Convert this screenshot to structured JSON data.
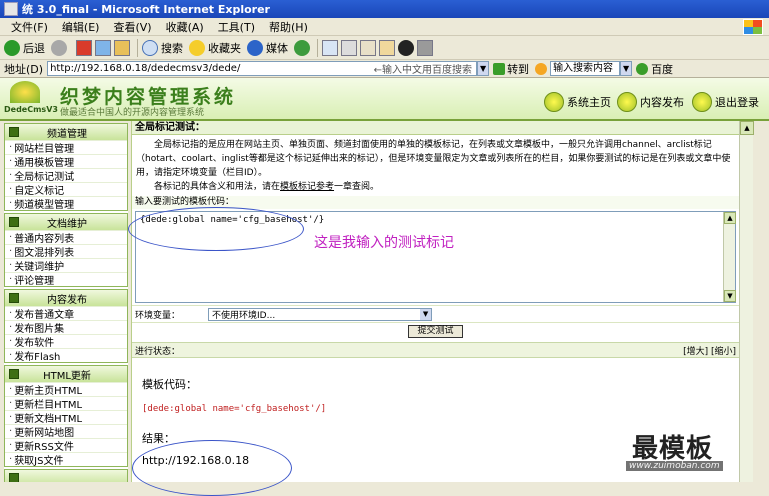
{
  "window": {
    "title": "统 3.0_final - Microsoft Internet Explorer"
  },
  "menu": [
    "文件(F)",
    "编辑(E)",
    "查看(V)",
    "收藏(A)",
    "工具(T)",
    "帮助(H)"
  ],
  "toolbar": {
    "back": "后退",
    "search": "搜索",
    "favorites": "收藏夹",
    "media": "媒体"
  },
  "address": {
    "label": "地址(D)",
    "url": "http://192.168.0.18/dedecmsv3/dede/",
    "hint": "←输入中文用百度搜索",
    "go": "转到",
    "search_placeholder": "输入搜索内容",
    "baidu": "百度"
  },
  "dede": {
    "title": "织梦内容管理系统",
    "subtitle": "做最适合中国人的开源内容管理系统",
    "logo_text": "DedeCmsV3",
    "links": [
      "系统主页",
      "内容发布",
      "退出登录"
    ]
  },
  "sidebar": [
    {
      "title": "频道管理",
      "items": [
        "网站栏目管理",
        "通用模板管理",
        "全局标记测试",
        "自定义标记",
        "频道模型管理"
      ]
    },
    {
      "title": "文档维护",
      "items": [
        "普通内容列表",
        "图文混排列表",
        "关键词维护",
        "评论管理"
      ]
    },
    {
      "title": "内容发布",
      "items": [
        "发布普通文章",
        "发布图片集",
        "发布软件",
        "发布Flash"
      ]
    },
    {
      "title": "HTML更新",
      "items": [
        "更新主页HTML",
        "更新栏目HTML",
        "更新文档HTML",
        "更新网站地图",
        "更新RSS文件",
        "获取JS文件"
      ]
    },
    {
      "title": "",
      "items": []
    }
  ],
  "main": {
    "section_title": "全局标记测试：",
    "intro_p1": "全局标记指的是应用在网站主页、单独页面、频道封面使用的单独的模板标记，在列表或文章模板中，一般只允许调用channel、arclist标记（hotart、coolart、inglist等都是这个标记延伸出来的标记），但是环境变量限定为文章或列表所在的栏目，如果你要测试的标记是在列表或文章中使用，请指定环境变量（栏目ID）。",
    "intro_p2_pre": "各标记的具体含义和用法，请在",
    "intro_p2_link": "模板标记参考",
    "intro_p2_post": "一章查阅。",
    "input_label": "输入要测试的模板代码：",
    "code": "{dede:global name='cfg_basehost'/}",
    "annotation": "这是我输入的测试标记",
    "env_label": "环境变量：",
    "env_value": "不使用环境ID...",
    "submit": "提交测试",
    "status_label": "进行状态：",
    "status_tools": "[增大] [缩小]",
    "template_label": "模板代码：",
    "template_code": "[dede:global name='cfg_basehost'/]",
    "result_label": "结果：",
    "result_value": "http://192.168.0.18"
  },
  "watermark": {
    "text": "最模板",
    "url": "www.zuimoban.com"
  }
}
